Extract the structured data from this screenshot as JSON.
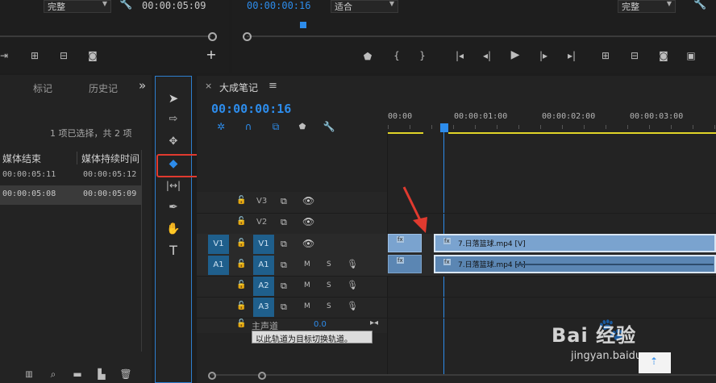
{
  "source_monitor": {
    "quality": "完整",
    "timecode": "00:00:05:09"
  },
  "program_monitor": {
    "timecode": "00:00:00:16",
    "fit": "适合",
    "quality": "完整"
  },
  "project_panel": {
    "tabs": [
      "标记",
      "历史记",
      "»"
    ],
    "selection_info": "1 项已选择，共 2 项",
    "columns": [
      "媒体结束",
      "媒体持续时间"
    ],
    "rows": [
      {
        "end": "00:00:05:11",
        "duration": "00:00:05:12"
      },
      {
        "end": "00:00:05:08",
        "duration": "00:00:05:09"
      }
    ]
  },
  "timeline": {
    "close": "×",
    "title": "大成笔记",
    "menu": "≡",
    "timecode": "00:00:00:16",
    "ruler": [
      "00:00",
      "00:00:01:00",
      "00:00:02:00",
      "00:00:03:00"
    ],
    "tracks": {
      "v3": "V3",
      "v2": "V2",
      "v1": "V1",
      "v1_src": "V1",
      "a1_src": "A1",
      "a1": "A1",
      "a2": "A2",
      "a3": "A3",
      "m": "M",
      "s": "S"
    },
    "master": {
      "label": "主声道",
      "value": "0.0"
    },
    "tooltip": "以此轨道为目标切换轨道。",
    "clips": {
      "video": "7.日落篮球.mp4 [V]",
      "audio": "7.日落篮球.mp4 [A]",
      "fx": "fx"
    }
  },
  "watermark": {
    "brand": "Bai 经验",
    "url": "jingyan.baidu.com"
  },
  "colors": {
    "accent_blue": "#2d8ceb",
    "highlight_red": "#e03a2f",
    "track_target": "#1f5f8c",
    "clip_video": "#7aa3cf",
    "clip_audio": "#5b86b3",
    "work_area": "#e0d428"
  }
}
